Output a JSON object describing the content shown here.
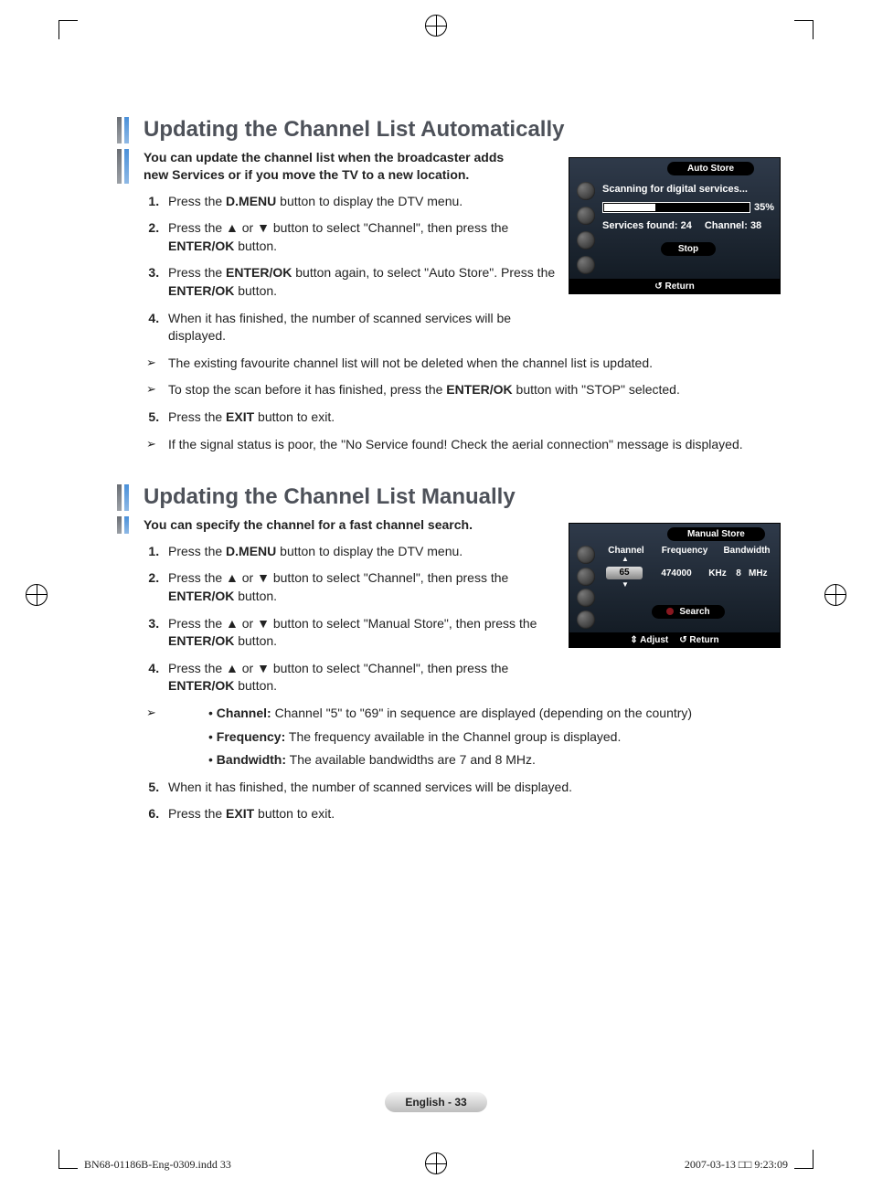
{
  "section1": {
    "title": "Updating the Channel List Automatically",
    "intro": "You can update the channel list when the broadcaster adds new Services or if you move the TV to a new location.",
    "steps": [
      {
        "pre": "Press the ",
        "b1": "D.MENU",
        "post": " button to display the DTV menu."
      },
      {
        "pre": "Press the ▲ or ▼ button to select \"Channel\", then press the ",
        "b1": "ENTER/OK",
        "post": " button."
      },
      {
        "pre": "Press the ",
        "b1": "ENTER/OK",
        "mid": " button again, to select \"Auto Store\". Press the ",
        "b2": "ENTER/OK",
        "post": " button."
      },
      {
        "pre": "When it has finished, the number of scanned services will be displayed.",
        "b1": "",
        "post": ""
      }
    ],
    "notes_a": [
      "The existing favourite channel list will not be deleted when the channel list is updated.",
      {
        "pre": "To stop the scan before it has finished, press the ",
        "b": "ENTER/OK",
        "post": " button with \"STOP\" selected."
      }
    ],
    "step5": {
      "pre": "Press the ",
      "b": "EXIT",
      "post": " button to exit."
    },
    "notes_b": [
      "If the signal status is poor, the \"No Service found! Check the aerial connection\" message is displayed."
    ],
    "osd": {
      "title": "Auto Store",
      "scanning": "Scanning for digital services...",
      "progress_pct_label": "35%",
      "progress_pct": 35,
      "services_found_label": "Services found: 24",
      "channel_label": "Channel: 38",
      "stop": "Stop",
      "return": "Return"
    }
  },
  "section2": {
    "title": "Updating the Channel List Manually",
    "intro": "You can specify the channel for a fast channel search.",
    "steps": [
      {
        "pre": "Press the ",
        "b1": "D.MENU",
        "post": " button to display the DTV menu."
      },
      {
        "pre": "Press the ▲ or ▼ button to select \"Channel\", then press the ",
        "b1": "ENTER/OK",
        "post": " button."
      },
      {
        "pre": "Press the ▲ or ▼ button to select \"Manual Store\", then press the ",
        "b1": "ENTER/OK",
        "post": " button."
      },
      {
        "pre": "Press the ▲ or ▼ button to select \"Channel\", then press the ",
        "b1": "ENTER/OK",
        "post": " button."
      }
    ],
    "sub": {
      "channel": {
        "label": "Channel:",
        "text": " Channel \"5\" to \"69\" in sequence are displayed (depending on the country)"
      },
      "frequency": {
        "label": "Frequency:",
        "text": " The frequency available in the Channel group is displayed."
      },
      "bandwidth": {
        "label": "Bandwidth:",
        "text": " The available bandwidths are 7 and 8 MHz."
      }
    },
    "step5": "When it has finished, the number of scanned services will be displayed.",
    "step6": {
      "pre": "Press the ",
      "b": "EXIT",
      "post": " button to exit."
    },
    "osd": {
      "title": "Manual Store",
      "h_channel": "Channel",
      "h_frequency": "Frequency",
      "h_bandwidth": "Bandwidth",
      "val_channel": "65",
      "val_frequency": "474000",
      "unit_khz": "KHz",
      "val_bandwidth": "8",
      "unit_mhz": "MHz",
      "search": "Search",
      "adjust": "Adjust",
      "return": "Return"
    }
  },
  "footer": {
    "page": "English - 33"
  },
  "imprint": {
    "file": "BN68-01186B-Eng-0309.indd   33",
    "timestamp": "2007-03-13   □□ 9:23:09"
  }
}
